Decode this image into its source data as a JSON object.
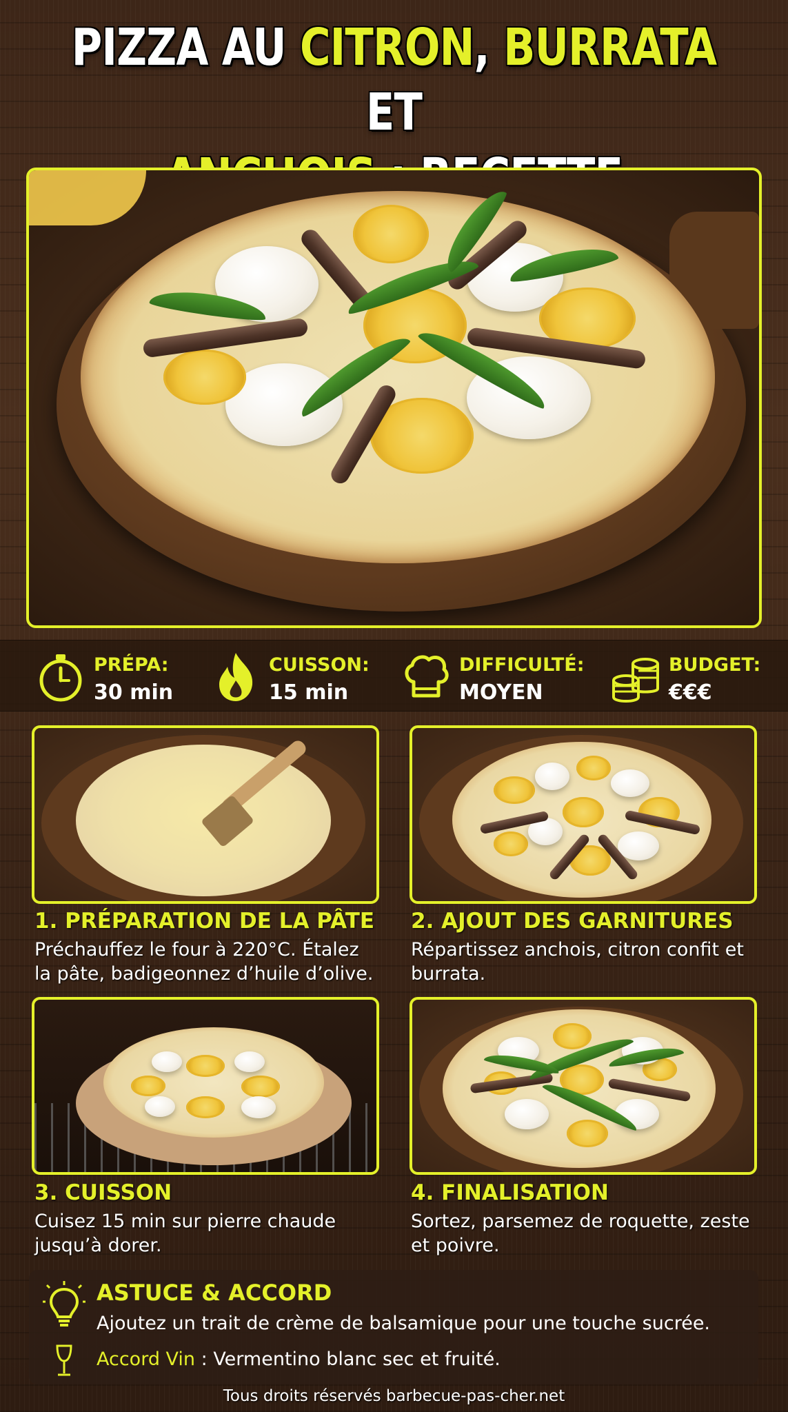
{
  "title": {
    "line1_part1": "PIZZA AU ",
    "line1_hl1": "CITRON",
    "line1_part2": ", ",
    "line1_hl2": "BURRATA",
    "line1_part3": " ET",
    "line2_hl": "ANCHOIS",
    "line2_part": " : RECETTE SAVOUREUSE"
  },
  "info": [
    {
      "label": "PRÉPA:",
      "value": "30 min",
      "icon": "stopwatch-icon"
    },
    {
      "label": "CUISSON:",
      "value": "15 min",
      "icon": "flame-icon"
    },
    {
      "label": "DIFFICULTÉ:",
      "value": "MOYEN",
      "icon": "chef-hat-icon"
    },
    {
      "label": "BUDGET:",
      "value": "€€€",
      "icon": "coins-icon"
    }
  ],
  "steps": [
    {
      "title": "1. PRÉPARATION DE LA PÂTE",
      "text_line1": "Préchauffez le four à 220°C. Étalez",
      "text_line2": "la pâte, badigeonnez d’huile d’olive."
    },
    {
      "title": "2. AJOUT DES GARNITURES",
      "text_line1": "Répartissez anchois, citron confit et",
      "text_line2": "burrata."
    },
    {
      "title": "3. CUISSON",
      "text_line1": "Cuisez 15 min sur pierre chaude",
      "text_line2": "jusqu’à dorer."
    },
    {
      "title": "4. FINALISATION",
      "text_line1": "Sortez, parsemez de roquette, zeste",
      "text_line2": "et poivre."
    }
  ],
  "tip": {
    "title": "ASTUCE & ACCORD",
    "text": "Ajoutez un trait de crème de balsamique pour une touche sucrée.",
    "wine_label": "Accord Vin",
    "wine_sep": " : ",
    "wine_text": "Vermentino blanc sec et fruité."
  },
  "footer": "Tous droits réservés barbecue-pas-cher.net",
  "colors": {
    "accent": "#e4f02a",
    "background": "#3d2618"
  }
}
